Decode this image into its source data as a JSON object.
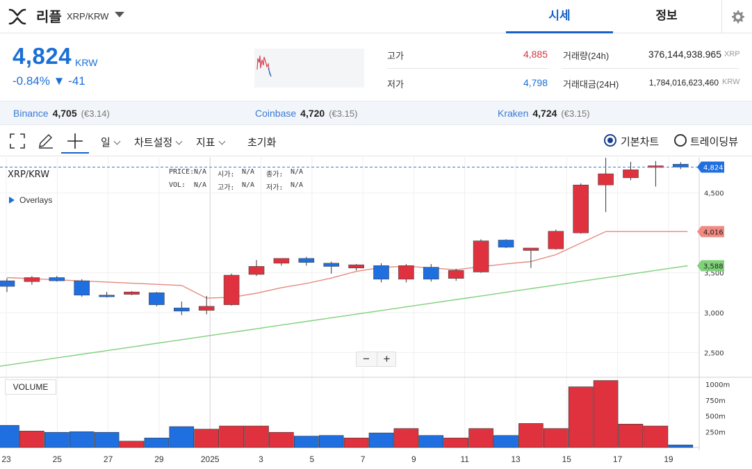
{
  "header": {
    "coin_name": "리플",
    "pair": "XRP/KRW",
    "tabs": [
      "시세",
      "정보"
    ]
  },
  "ticker": {
    "price": "4,824",
    "unit": "KRW",
    "change_pct": "-0.84%",
    "change_abs": "▼ -41",
    "high_label": "고가",
    "high_value": "4,885",
    "low_label": "저가",
    "low_value": "4,798",
    "volume_label": "거래량(24h)",
    "volume_value": "376,144,938.965",
    "volume_unit": "XRP",
    "amount_label": "거래대금(24H)",
    "amount_value": "1,784,016,623,460",
    "amount_unit": "KRW"
  },
  "exchanges": [
    {
      "name": "Binance",
      "price": "4,705",
      "eur": "(€3.14)"
    },
    {
      "name": "Coinbase",
      "price": "4,720",
      "eur": "(€3.15)"
    },
    {
      "name": "Kraken",
      "price": "4,724",
      "eur": "(€3.15)"
    }
  ],
  "toolbar": {
    "period": "일",
    "chart_settings": "차트설정",
    "indicators": "지표",
    "reset": "초기화",
    "basic_chart": "기본차트",
    "tradingview": "트레이딩뷰"
  },
  "chart_legend": {
    "pair": "XRP/KRW",
    "price_lbl": "PRICE:",
    "price_val": "N/A",
    "open_lbl": "시가:",
    "open_val": "N/A",
    "close_lbl": "종가:",
    "close_val": "N/A",
    "vol_lbl": "VOL:",
    "vol_val": "N/A",
    "high_lbl": "고가:",
    "high_val": "N/A",
    "low_lbl": "저가:",
    "low_val": "N/A",
    "overlays": "Overlays",
    "volume_panel": "VOLUME"
  },
  "colors": {
    "up": "#e0323e",
    "down": "#1f6fe0",
    "accent": "#1760c8",
    "ma_short": "#e4897c",
    "ma_long": "#7ed07a"
  },
  "chart_data": {
    "type": "candlestick",
    "x_tick_labels": [
      "23",
      "25",
      "27",
      "29",
      "2025",
      "3",
      "5",
      "7",
      "9",
      "11",
      "13",
      "15",
      "17",
      "19"
    ],
    "y_tick_labels": [
      "4,500",
      "3,500",
      "3,000",
      "2,500"
    ],
    "volume_tick_labels": [
      "1000m",
      "750m",
      "500m",
      "250m"
    ],
    "price_ylim": [
      2200,
      4950
    ],
    "volume_ylim": [
      0,
      1100
    ],
    "candles": [
      {
        "o": 3400,
        "h": 3430,
        "l": 3260,
        "c": 3330,
        "v": 350
      },
      {
        "o": 3390,
        "h": 3460,
        "l": 3350,
        "c": 3440,
        "v": 260
      },
      {
        "o": 3440,
        "h": 3460,
        "l": 3390,
        "c": 3400,
        "v": 240
      },
      {
        "o": 3400,
        "h": 3420,
        "l": 3200,
        "c": 3220,
        "v": 250
      },
      {
        "o": 3220,
        "h": 3260,
        "l": 3190,
        "c": 3200,
        "v": 240
      },
      {
        "o": 3230,
        "h": 3270,
        "l": 3220,
        "c": 3260,
        "v": 100
      },
      {
        "o": 3250,
        "h": 3260,
        "l": 3080,
        "c": 3100,
        "v": 150
      },
      {
        "o": 3060,
        "h": 3140,
        "l": 2970,
        "c": 3020,
        "v": 330
      },
      {
        "o": 3030,
        "h": 3210,
        "l": 2980,
        "c": 3080,
        "v": 290
      },
      {
        "o": 3100,
        "h": 3490,
        "l": 3090,
        "c": 3470,
        "v": 340
      },
      {
        "o": 3480,
        "h": 3660,
        "l": 3460,
        "c": 3580,
        "v": 340
      },
      {
        "o": 3620,
        "h": 3660,
        "l": 3590,
        "c": 3680,
        "v": 240
      },
      {
        "o": 3680,
        "h": 3700,
        "l": 3590,
        "c": 3630,
        "v": 180
      },
      {
        "o": 3620,
        "h": 3640,
        "l": 3490,
        "c": 3580,
        "v": 190
      },
      {
        "o": 3560,
        "h": 3610,
        "l": 3530,
        "c": 3600,
        "v": 150
      },
      {
        "o": 3590,
        "h": 3620,
        "l": 3380,
        "c": 3420,
        "v": 230
      },
      {
        "o": 3420,
        "h": 3610,
        "l": 3380,
        "c": 3590,
        "v": 300
      },
      {
        "o": 3570,
        "h": 3610,
        "l": 3390,
        "c": 3420,
        "v": 190
      },
      {
        "o": 3430,
        "h": 3550,
        "l": 3400,
        "c": 3530,
        "v": 150
      },
      {
        "o": 3510,
        "h": 3920,
        "l": 3500,
        "c": 3900,
        "v": 300
      },
      {
        "o": 3910,
        "h": 3920,
        "l": 3810,
        "c": 3820,
        "v": 190
      },
      {
        "o": 3780,
        "h": 3810,
        "l": 3560,
        "c": 3810,
        "v": 380
      },
      {
        "o": 3800,
        "h": 4040,
        "l": 3790,
        "c": 4020,
        "v": 300
      },
      {
        "o": 4000,
        "h": 4620,
        "l": 3990,
        "c": 4600,
        "v": 960
      },
      {
        "o": 4600,
        "h": 4940,
        "l": 4260,
        "c": 4740,
        "v": 1060
      },
      {
        "o": 4690,
        "h": 4890,
        "l": 4660,
        "c": 4790,
        "v": 370
      },
      {
        "o": 4820,
        "h": 4900,
        "l": 4580,
        "c": 4840,
        "v": 340
      },
      {
        "o": 4860,
        "h": 4885,
        "l": 4798,
        "c": 4824,
        "v": 40
      }
    ],
    "ma_short": {
      "name": "",
      "value": 4016
    },
    "ma_long": {
      "name": "",
      "value": 3588
    },
    "last_price": 4824
  }
}
